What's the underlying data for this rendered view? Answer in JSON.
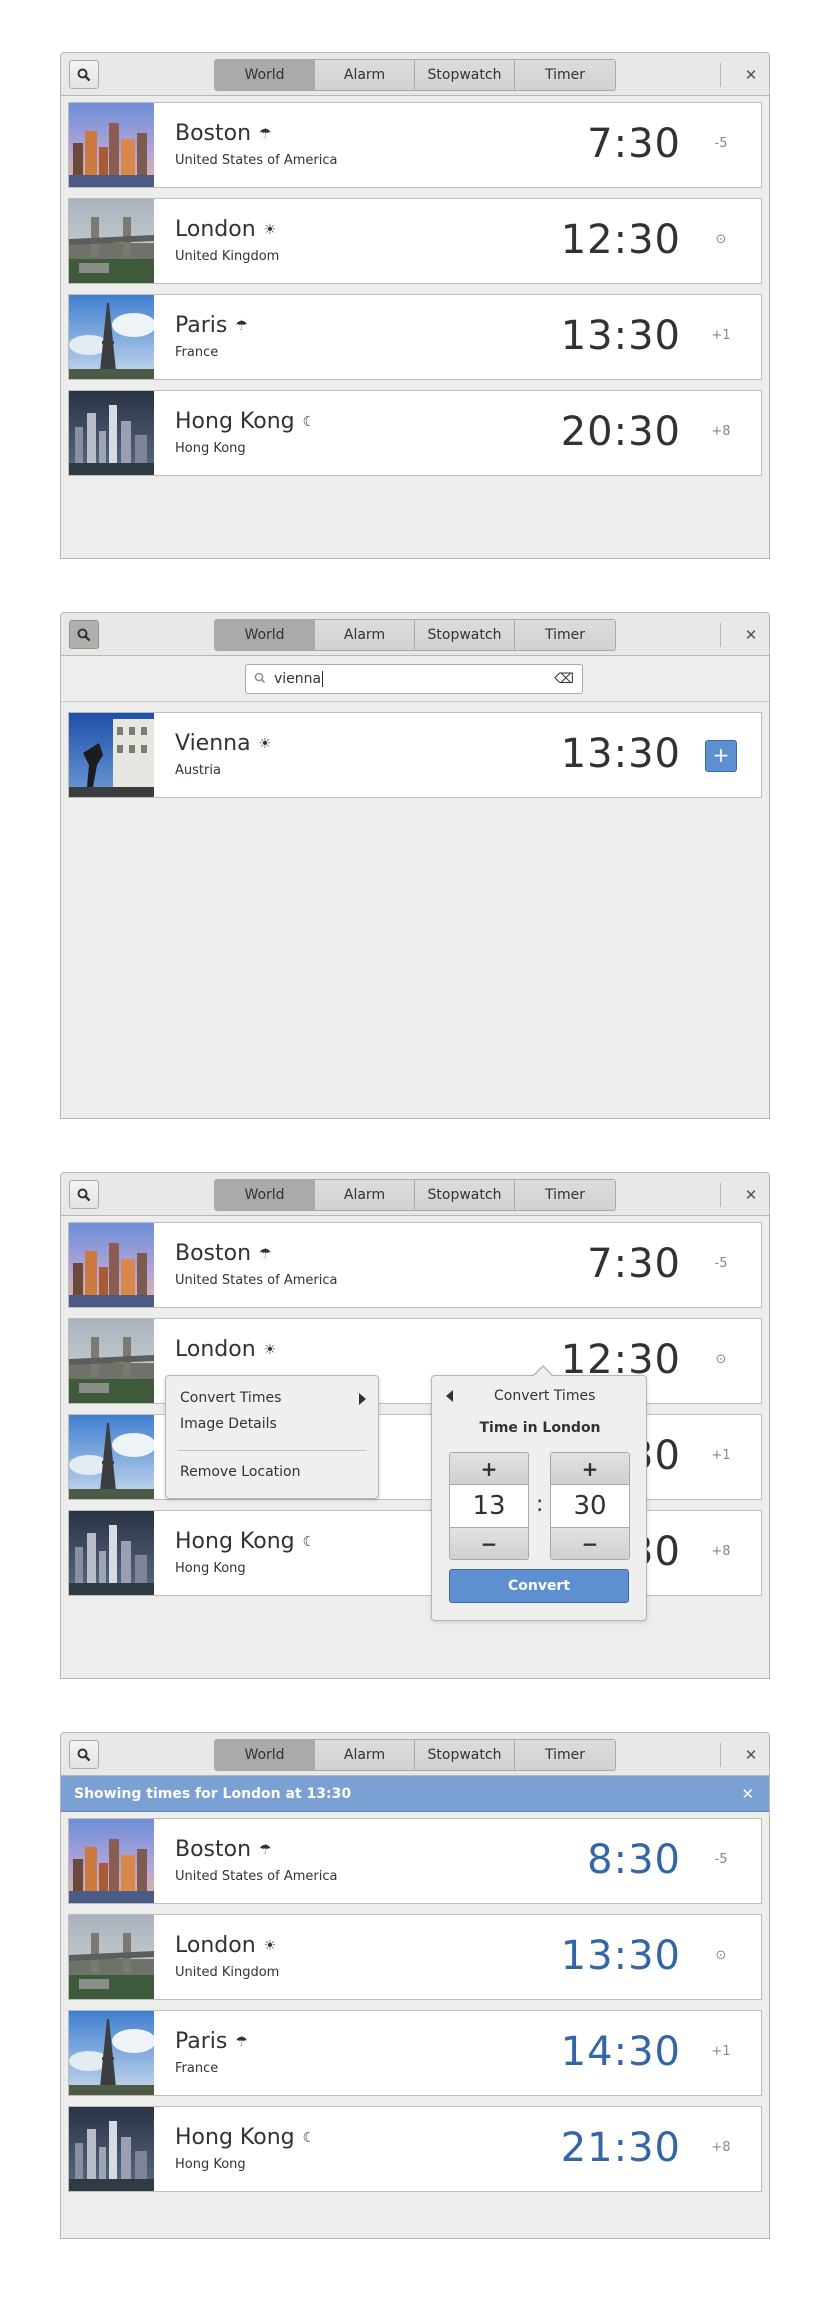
{
  "header": {
    "tabs": [
      "World",
      "Alarm",
      "Stopwatch",
      "Timer"
    ],
    "active_tab": "World",
    "search_icon": "search-icon",
    "close_icon": "close-icon",
    "close_glyph": "✕"
  },
  "panel1": {
    "rows": [
      {
        "city": "Boston",
        "weather": "☂",
        "country": "United States of America",
        "time": "7:30",
        "offset": "-5"
      },
      {
        "city": "London",
        "weather": "☀",
        "country": "United Kingdom",
        "time": "12:30",
        "offset": "⊙"
      },
      {
        "city": "Paris",
        "weather": "☂",
        "country": "France",
        "time": "13:30",
        "offset": "+1"
      },
      {
        "city": "Hong Kong",
        "weather": "☾",
        "country": "Hong Kong",
        "time": "20:30",
        "offset": "+8"
      }
    ]
  },
  "panel2": {
    "search": {
      "value": "vienna",
      "clear_glyph": "⌫"
    },
    "result": {
      "city": "Vienna",
      "weather": "☀",
      "country": "Austria",
      "time": "13:30",
      "add_label": "+"
    }
  },
  "panel3": {
    "rows": [
      {
        "city": "Boston",
        "weather": "☂",
        "country": "United States of America",
        "time": "7:30",
        "offset": "-5"
      },
      {
        "city": "London",
        "weather": "☀",
        "country": "",
        "time": "12:30",
        "offset": "⊙"
      },
      {
        "city": "",
        "weather": "",
        "country": "",
        "time": "30",
        "offset": "+1"
      },
      {
        "city": "Hong Kong",
        "weather": "☾",
        "country": "Hong Kong",
        "time": "30",
        "offset": "+8"
      }
    ],
    "context_menu": {
      "convert": "Convert Times",
      "details": "Image Details",
      "remove": "Remove Location"
    },
    "popover": {
      "back_title": "Convert Times",
      "subtitle": "Time in London",
      "hours": "13",
      "minutes": "30",
      "plus": "+",
      "minus": "−",
      "colon": ":",
      "button": "Convert"
    }
  },
  "panel4": {
    "notice": "Showing times for London at 13:30",
    "rows": [
      {
        "city": "Boston",
        "weather": "☂",
        "country": "United States of America",
        "time": "8:30",
        "offset": "-5"
      },
      {
        "city": "London",
        "weather": "☀",
        "country": "United Kingdom",
        "time": "13:30",
        "offset": "⊙"
      },
      {
        "city": "Paris",
        "weather": "☂",
        "country": "France",
        "time": "14:30",
        "offset": "+1"
      },
      {
        "city": "Hong Kong",
        "weather": "☾",
        "country": "Hong Kong",
        "time": "21:30",
        "offset": "+8"
      }
    ]
  },
  "colors": {
    "accent": "#5e8fd1",
    "notice": "#7ba0d4",
    "converted_time": "#3465a4"
  }
}
